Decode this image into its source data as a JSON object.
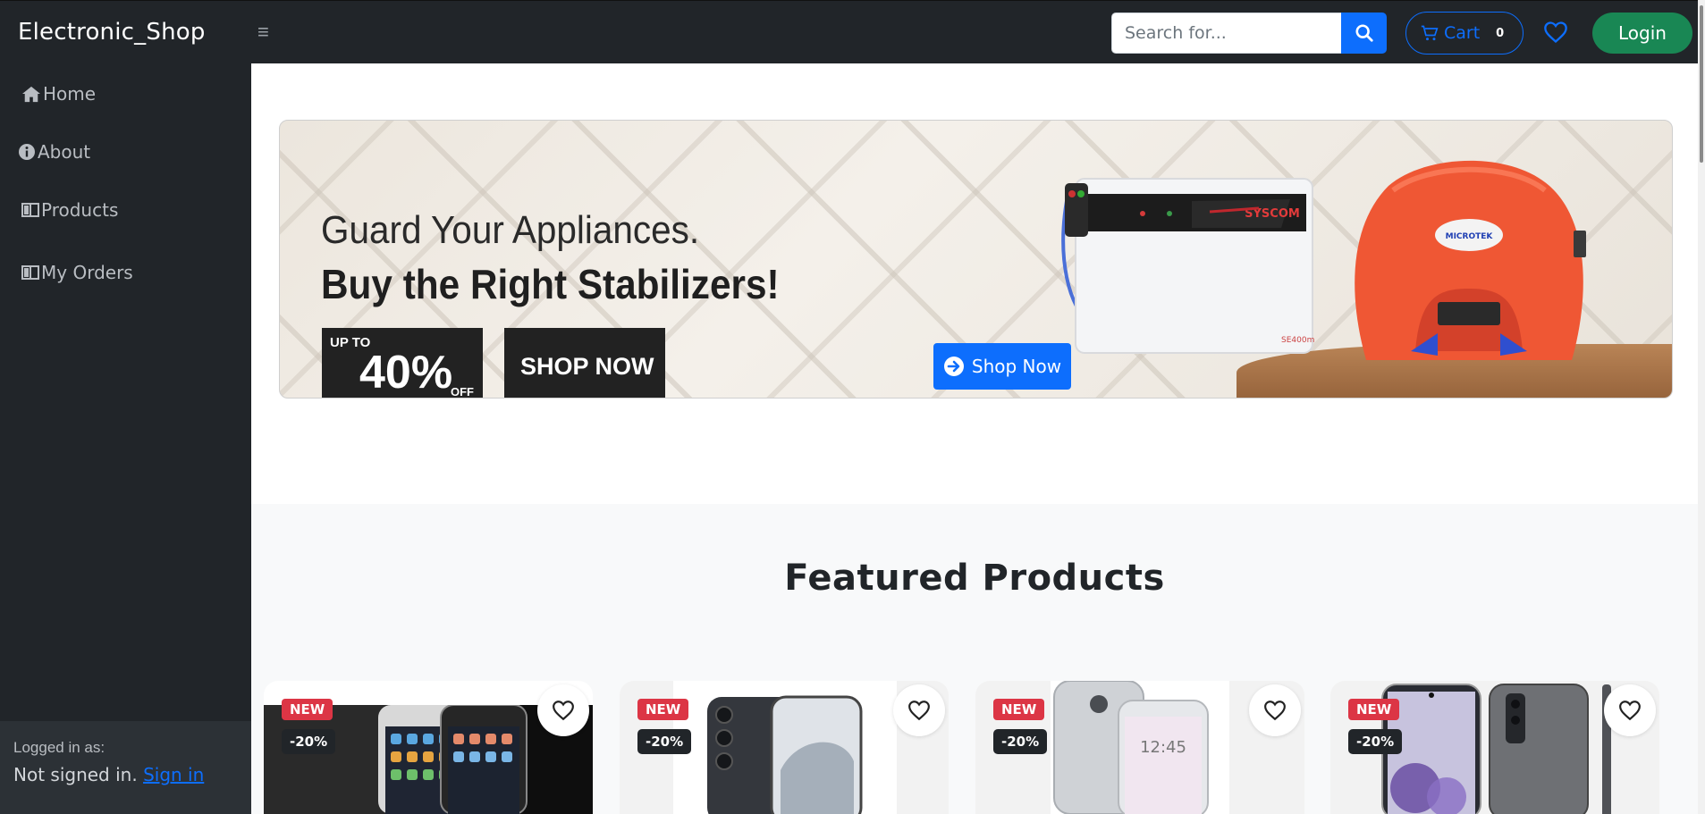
{
  "navbar": {
    "brand": "Electronic_Shop",
    "menu_icon": "hamburger-icon",
    "search_placeholder": "Search for...",
    "cart_label": "Cart",
    "cart_count": "0",
    "login_label": "Login"
  },
  "sidebar": {
    "items": [
      {
        "label": "Home",
        "icon": "home-icon"
      },
      {
        "label": "About",
        "icon": "info-icon"
      },
      {
        "label": "Products",
        "icon": "book-icon"
      },
      {
        "label": "My Orders",
        "icon": "book-icon"
      }
    ],
    "footer": {
      "logged_label": "Logged in as:",
      "status": "Not signed in.",
      "signin_label": "Sign in"
    }
  },
  "hero": {
    "line1": "Guard Your Appliances.",
    "line2": "Buy the Right Stabilizers!",
    "promo_upto": "UP TO",
    "promo_percent": "40%",
    "promo_off": "OFF",
    "promo_shop": "SHOP NOW",
    "stabilizer_brand": "SYSCOM",
    "stabilizer_model": "SE400m",
    "helmet_brand": "MICROTEK",
    "cta_label": "Shop Now"
  },
  "featured": {
    "title": "Featured Products",
    "products": [
      {
        "badge": "NEW",
        "discount": "-20%"
      },
      {
        "badge": "NEW",
        "discount": "-20%"
      },
      {
        "badge": "NEW",
        "discount": "-20%"
      },
      {
        "badge": "NEW",
        "discount": "-20%"
      }
    ]
  },
  "colors": {
    "navbar_bg": "#212529",
    "primary": "#0d6efd",
    "success": "#198754",
    "danger": "#dc3545",
    "featured_bg": "#f8f9fa"
  }
}
